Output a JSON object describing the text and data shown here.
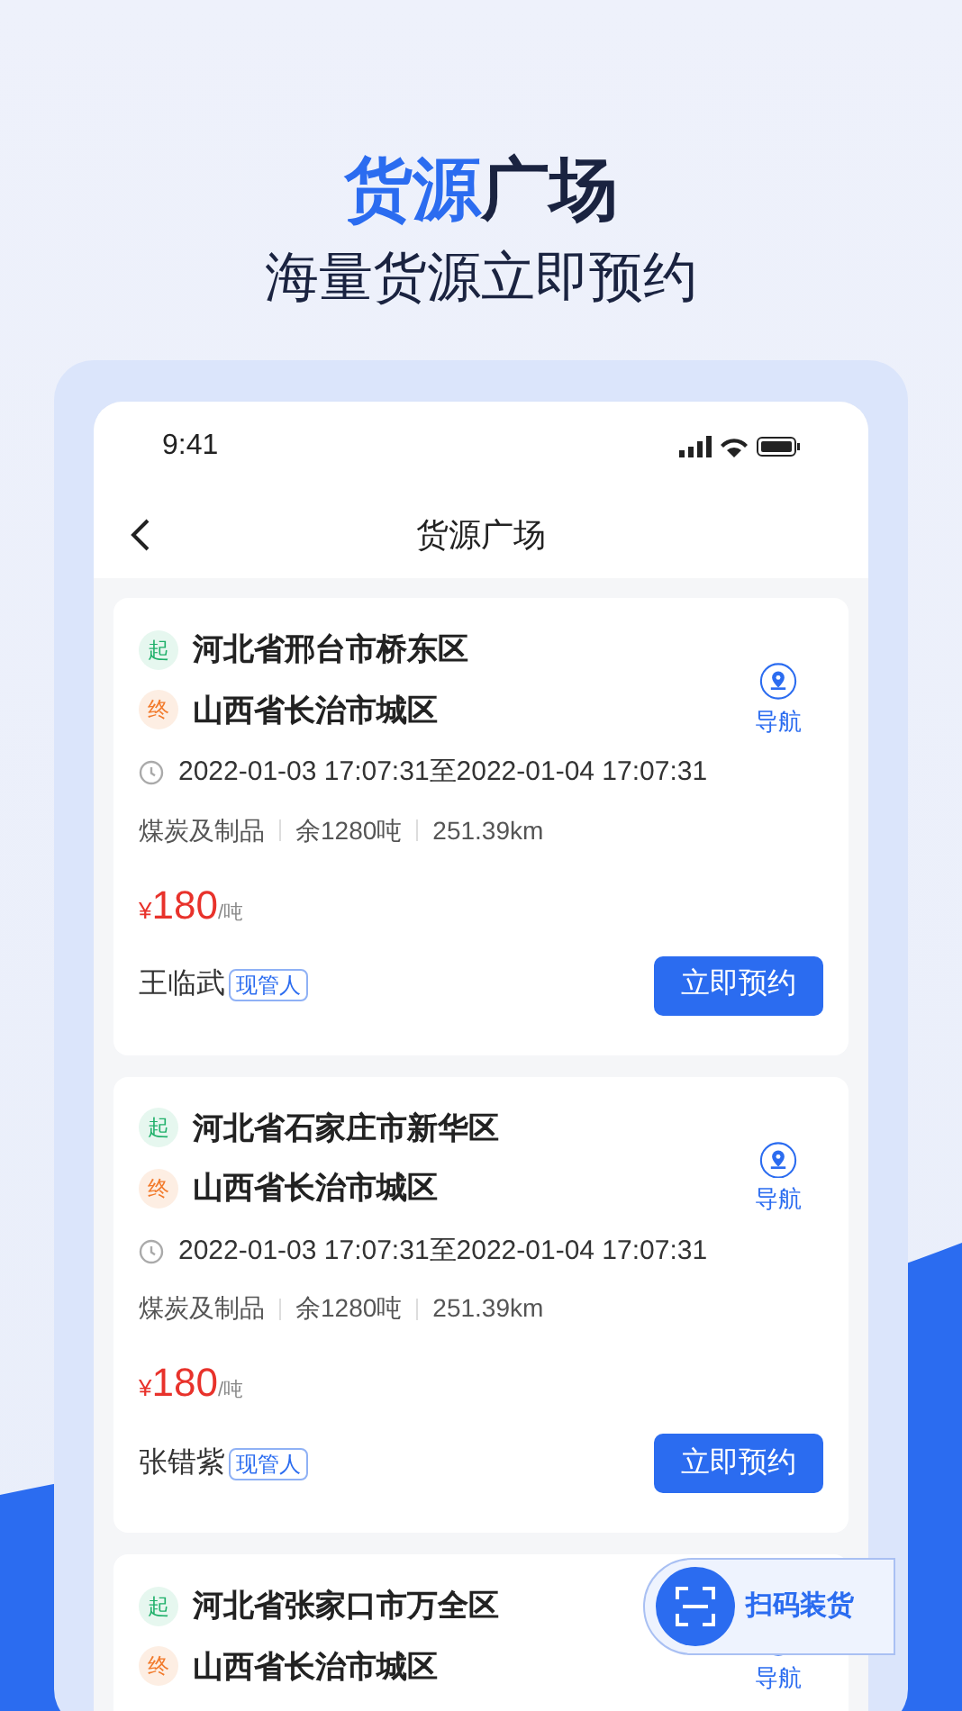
{
  "headline": {
    "highlight": "货源",
    "rest": "广场"
  },
  "subtitle": "海量货源立即预约",
  "status_bar": {
    "time": "9:41"
  },
  "nav_bar": {
    "title": "货源广场"
  },
  "cards": [
    {
      "start_tag": "起",
      "start": "河北省邢台市桥东区",
      "end_tag": "终",
      "end": "山西省长治市城区",
      "nav_label": "导航",
      "time": "2022-01-03 17:07:31至2022-01-04 17:07:31",
      "cargo": "煤炭及制品",
      "remaining": "余1280吨",
      "distance": "251.39km",
      "currency": "¥",
      "price": "180",
      "unit": "/吨",
      "person": "王临武",
      "role": "现管人",
      "action": "立即预约"
    },
    {
      "start_tag": "起",
      "start": "河北省石家庄市新华区",
      "end_tag": "终",
      "end": "山西省长治市城区",
      "nav_label": "导航",
      "time": "2022-01-03 17:07:31至2022-01-04 17:07:31",
      "cargo": "煤炭及制品",
      "remaining": "余1280吨",
      "distance": "251.39km",
      "currency": "¥",
      "price": "180",
      "unit": "/吨",
      "person": "张错紫",
      "role": "现管人",
      "action": "立即预约"
    },
    {
      "start_tag": "起",
      "start": "河北省张家口市万全区",
      "end_tag": "终",
      "end": "山西省长治市城区",
      "nav_label": "导航"
    }
  ],
  "scan_button": {
    "label": "扫码装货"
  }
}
